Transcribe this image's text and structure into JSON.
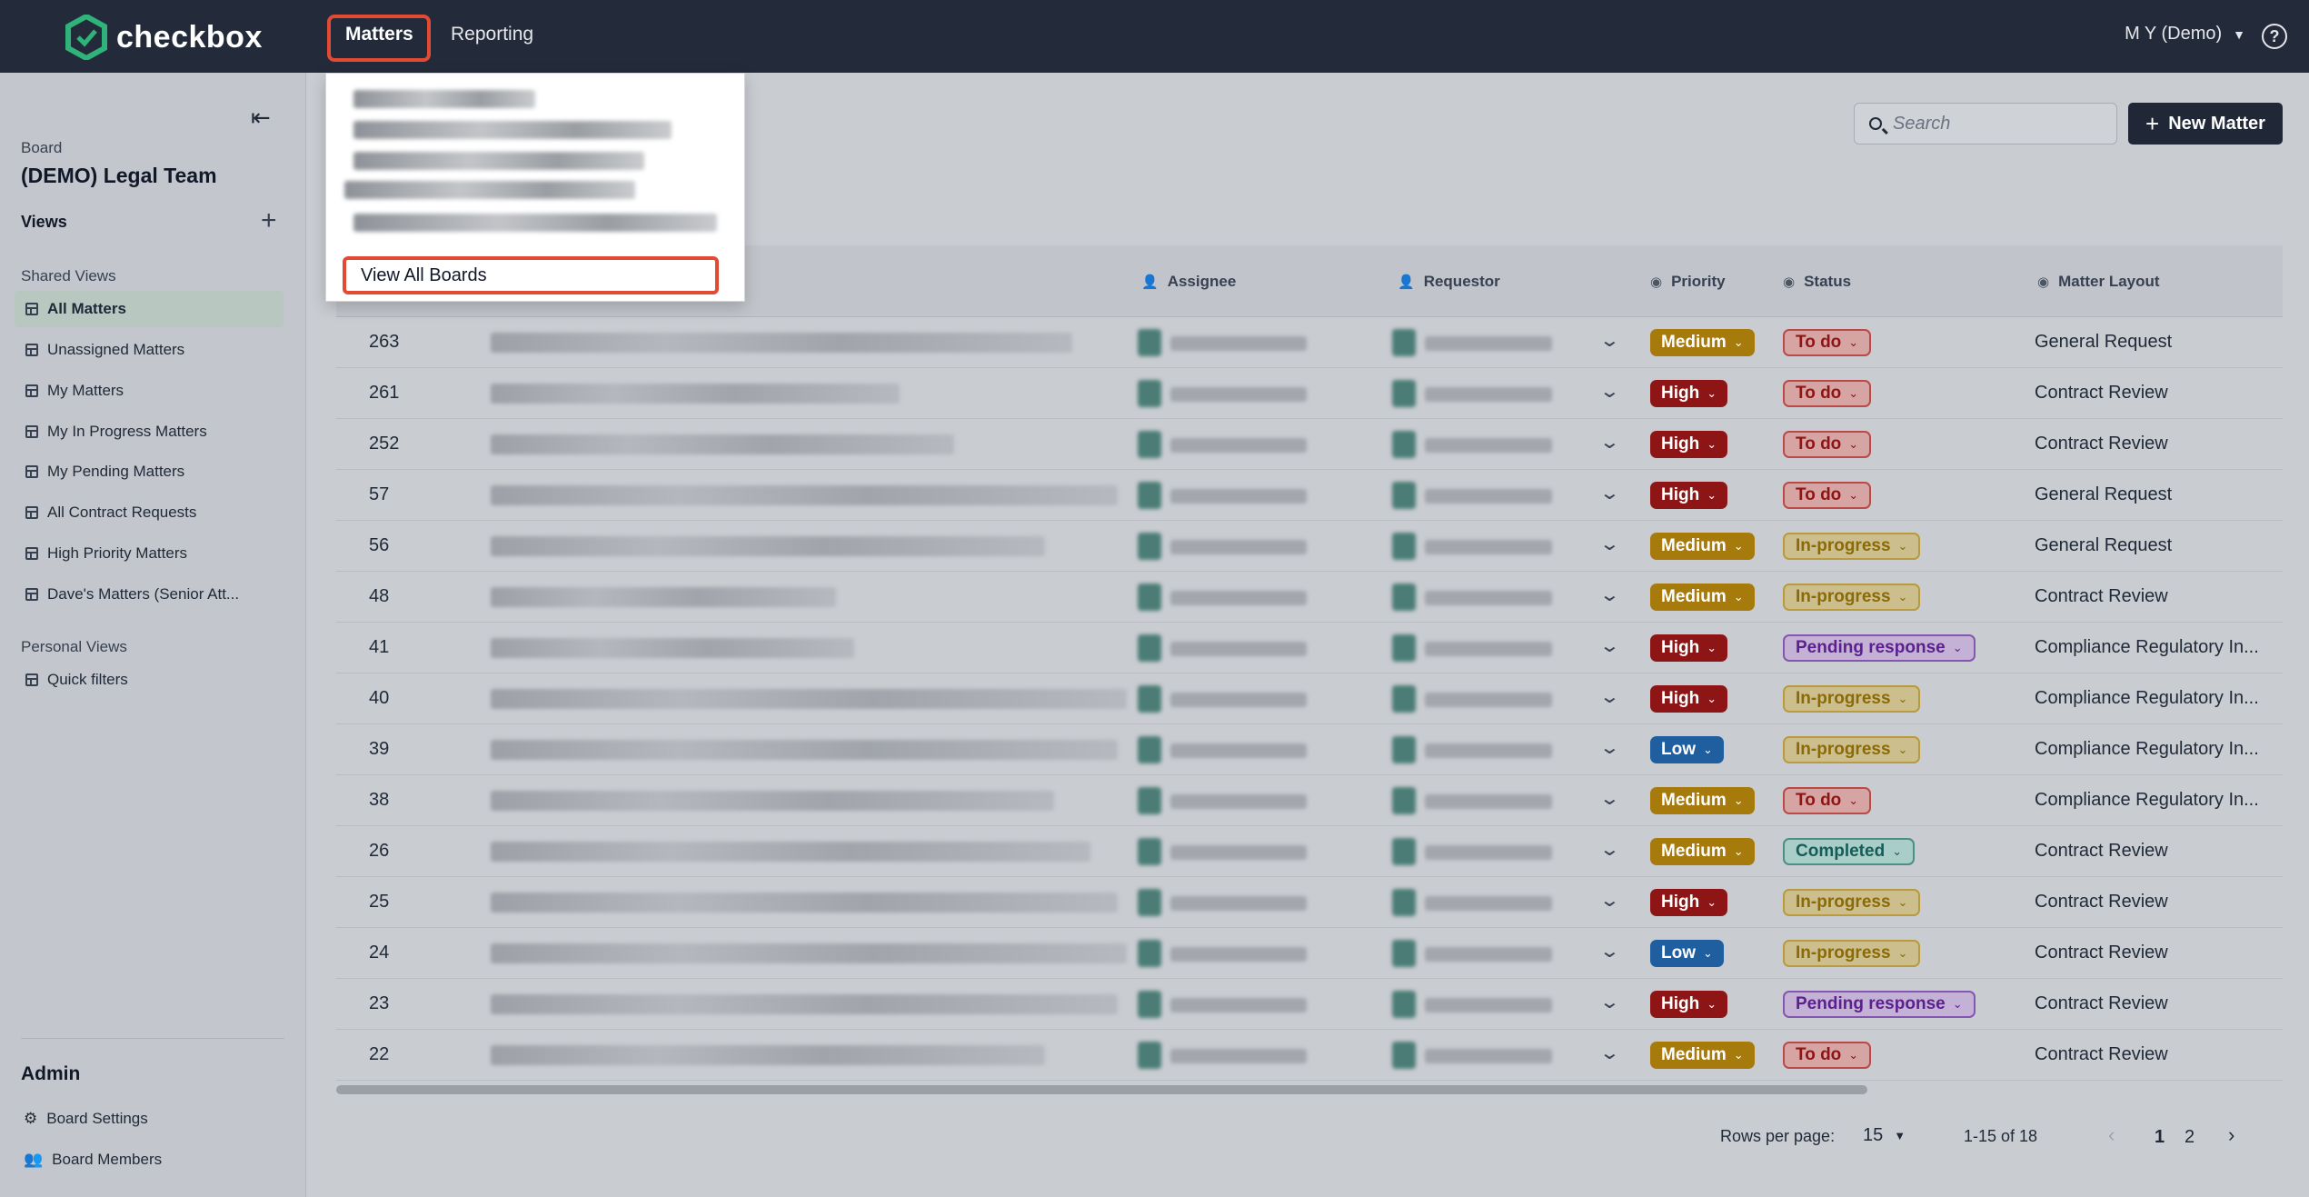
{
  "topbar": {
    "brand": "checkbox",
    "nav": [
      {
        "label": "Matters"
      },
      {
        "label": "Reporting"
      }
    ],
    "user": "M Y (Demo)",
    "help_icon": "?"
  },
  "sidebar": {
    "board_label": "Board",
    "board_name": "(DEMO) Legal Team",
    "views_label": "Views",
    "shared_views_label": "Shared Views",
    "shared_views": [
      {
        "label": "All Matters"
      },
      {
        "label": "Unassigned Matters"
      },
      {
        "label": "My Matters"
      },
      {
        "label": "My In Progress Matters"
      },
      {
        "label": "My Pending Matters"
      },
      {
        "label": "All Contract Requests"
      },
      {
        "label": "High Priority Matters"
      },
      {
        "label": "Dave's Matters (Senior Att..."
      }
    ],
    "personal_views_label": "Personal Views",
    "personal_views": [
      {
        "label": "Quick filters"
      }
    ],
    "admin_label": "Admin",
    "admin_items": [
      {
        "label": "Board Settings"
      },
      {
        "label": "Board Members"
      }
    ]
  },
  "toolbar": {
    "search_placeholder": "Search",
    "new_matter_label": "New Matter"
  },
  "matters_dropdown": {
    "view_all_label": "View All Boards"
  },
  "table": {
    "headers": {
      "assignee": "Assignee",
      "requestor": "Requestor",
      "priority": "Priority",
      "status": "Status",
      "layout": "Matter Layout"
    },
    "rows": [
      {
        "id": "263",
        "priority": "Medium",
        "status": "To do",
        "layout": "General Request"
      },
      {
        "id": "261",
        "priority": "High",
        "status": "To do",
        "layout": "Contract Review"
      },
      {
        "id": "252",
        "priority": "High",
        "status": "To do",
        "layout": "Contract Review"
      },
      {
        "id": "57",
        "priority": "High",
        "status": "To do",
        "layout": "General Request"
      },
      {
        "id": "56",
        "priority": "Medium",
        "status": "In-progress",
        "layout": "General Request"
      },
      {
        "id": "48",
        "priority": "Medium",
        "status": "In-progress",
        "layout": "Contract Review"
      },
      {
        "id": "41",
        "priority": "High",
        "status": "Pending response",
        "layout": "Compliance Regulatory In..."
      },
      {
        "id": "40",
        "priority": "High",
        "status": "In-progress",
        "layout": "Compliance Regulatory In..."
      },
      {
        "id": "39",
        "priority": "Low",
        "status": "In-progress",
        "layout": "Compliance Regulatory In..."
      },
      {
        "id": "38",
        "priority": "Medium",
        "status": "To do",
        "layout": "Compliance Regulatory In..."
      },
      {
        "id": "26",
        "priority": "Medium",
        "status": "Completed",
        "layout": "Contract Review"
      },
      {
        "id": "25",
        "priority": "High",
        "status": "In-progress",
        "layout": "Contract Review"
      },
      {
        "id": "24",
        "priority": "Low",
        "status": "In-progress",
        "layout": "Contract Review"
      },
      {
        "id": "23",
        "priority": "High",
        "status": "Pending response",
        "layout": "Contract Review"
      },
      {
        "id": "22",
        "priority": "Medium",
        "status": "To do",
        "layout": "Contract Review"
      }
    ]
  },
  "pagination": {
    "rows_per_page_label": "Rows per page:",
    "rows_per_page": "15",
    "range": "1-15 of 18",
    "pages": [
      "1",
      "2"
    ],
    "current_page": "1"
  },
  "colors": {
    "topbar": "#232b3a",
    "priority_medium": "#a67b0c",
    "priority_high": "#8e1515",
    "priority_low": "#1f5f9f",
    "highlight": "#e24a33"
  }
}
